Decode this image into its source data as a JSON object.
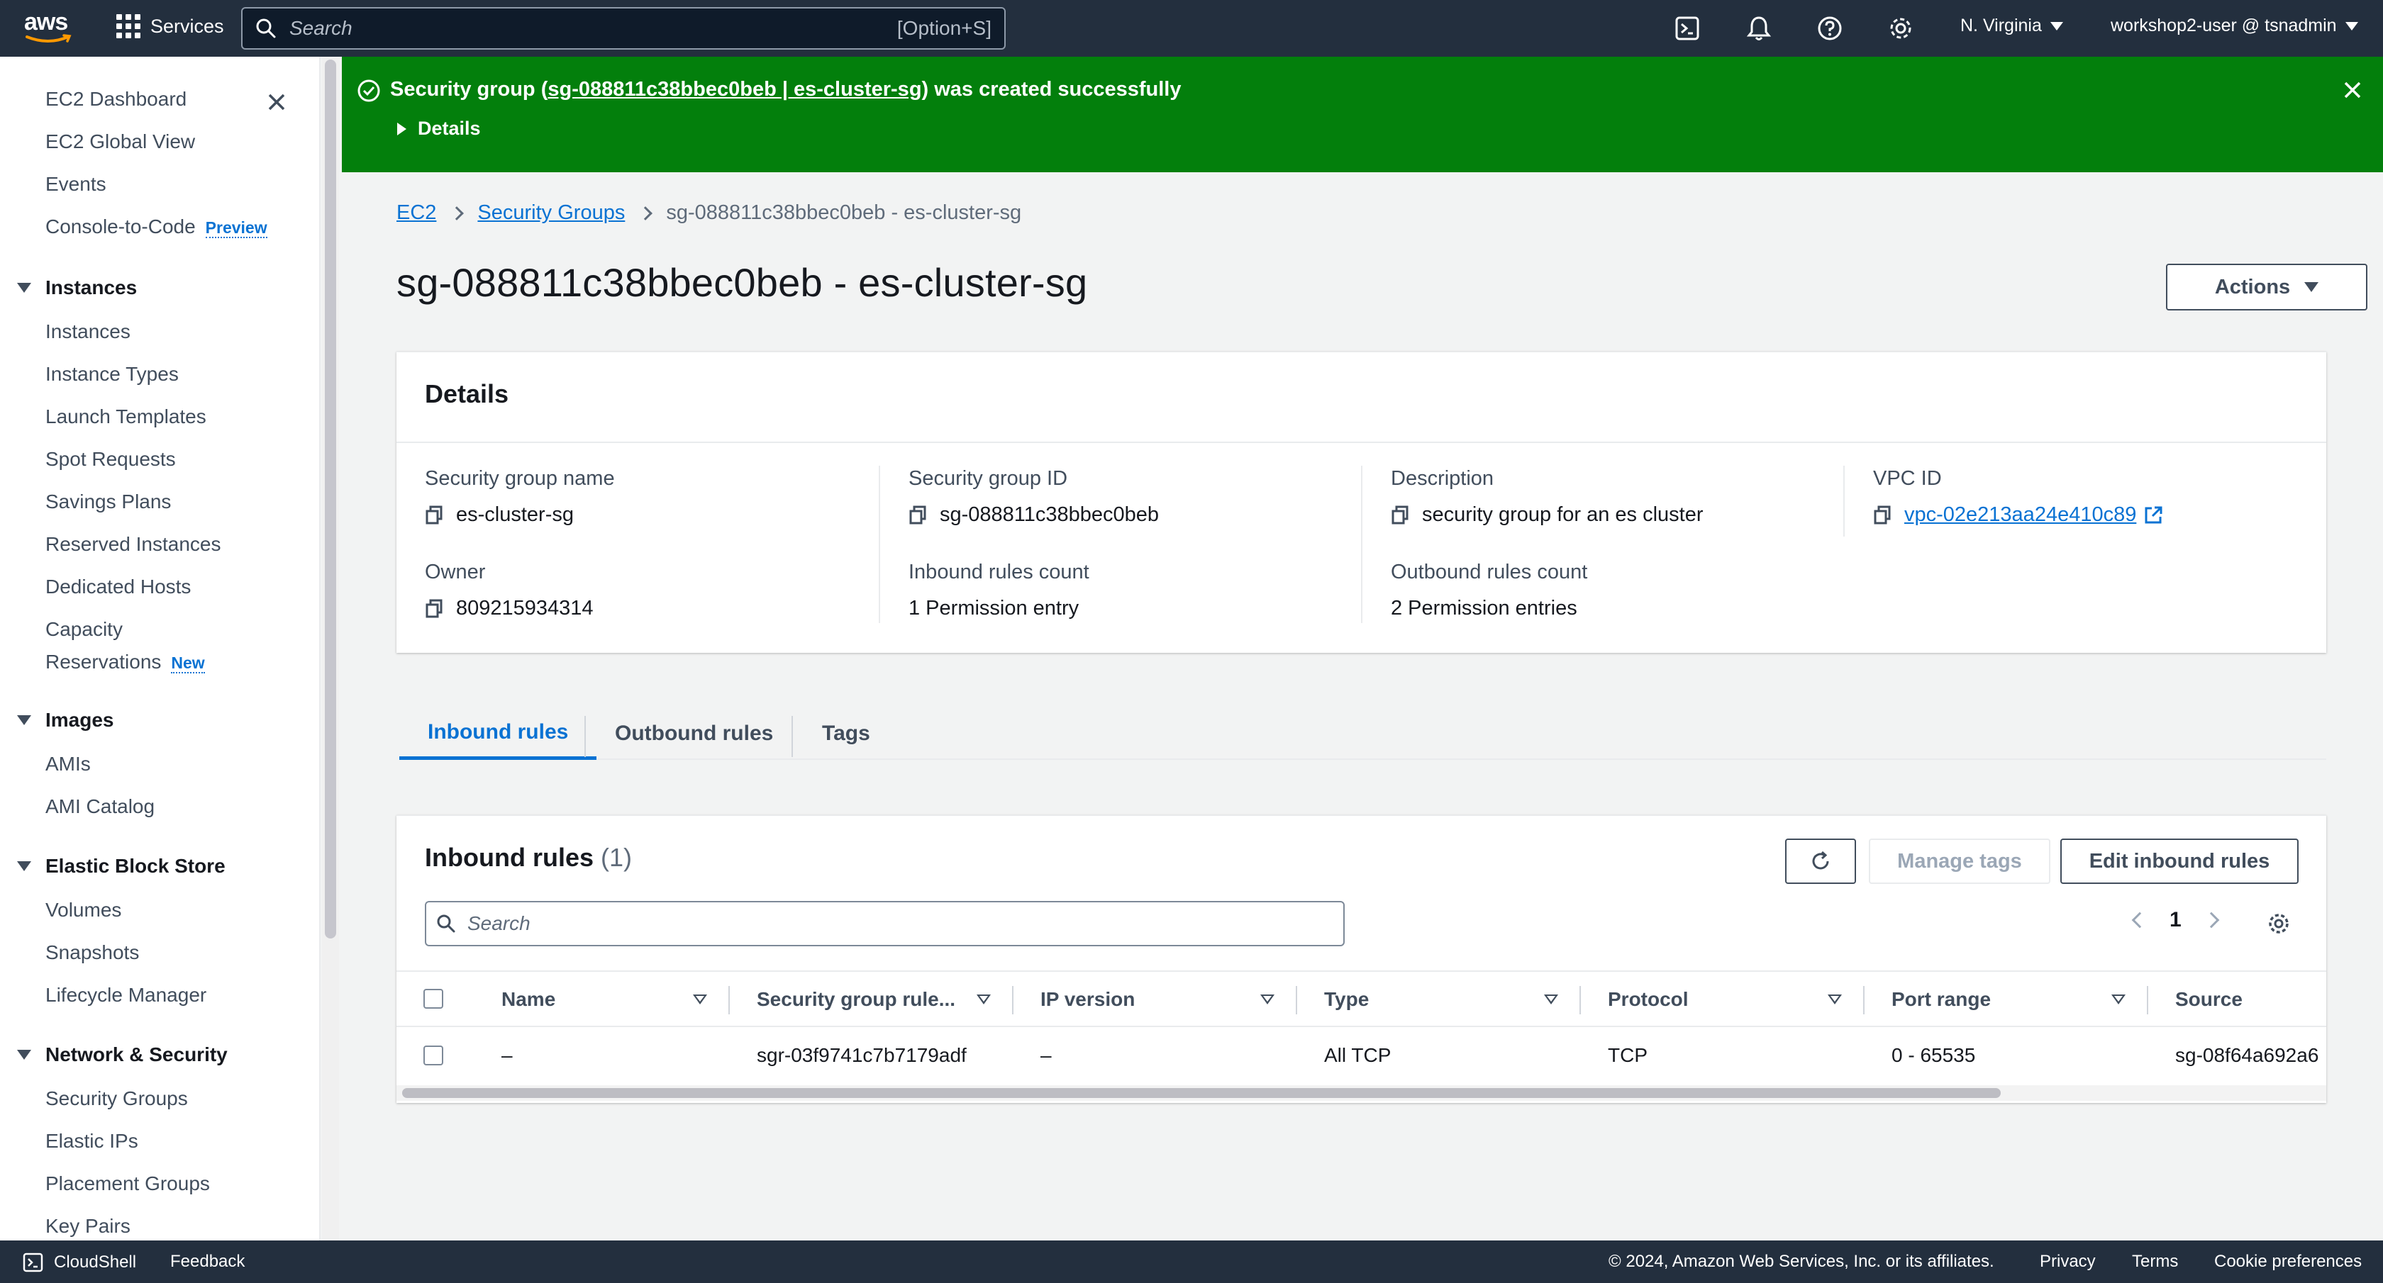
{
  "topnav": {
    "logo_text": "aws",
    "services_label": "Services",
    "search_placeholder": "Search",
    "search_shortcut": "[Option+S]",
    "icons": [
      "cloudshell-icon",
      "bell-icon",
      "help-icon",
      "gear-icon"
    ],
    "region": "N. Virginia",
    "account": "workshop2-user @ tsnadmin"
  },
  "sidebar": {
    "top_items": [
      {
        "label": "EC2 Dashboard"
      },
      {
        "label": "EC2 Global View"
      },
      {
        "label": "Events"
      },
      {
        "label": "Console-to-Code",
        "badge": "Preview"
      }
    ],
    "sections": [
      {
        "title": "Instances",
        "items": [
          "Instances",
          "Instance Types",
          "Launch Templates",
          "Spot Requests",
          "Savings Plans",
          "Reserved Instances",
          "Dedicated Hosts",
          "Capacity",
          "Reservations"
        ],
        "badge": "New"
      },
      {
        "title": "Images",
        "items": [
          "AMIs",
          "AMI Catalog"
        ]
      },
      {
        "title": "Elastic Block Store",
        "items": [
          "Volumes",
          "Snapshots",
          "Lifecycle Manager"
        ]
      },
      {
        "title": "Network & Security",
        "items": [
          "Security Groups",
          "Elastic IPs",
          "Placement Groups",
          "Key Pairs"
        ]
      }
    ]
  },
  "flash": {
    "prefix": "Security group (",
    "link": "sg-088811c38bbec0beb | es-cluster-sg",
    "suffix": ") was created successfully",
    "details_label": "Details",
    "color": "#037f0c"
  },
  "breadcrumb": {
    "items": [
      "EC2",
      "Security Groups"
    ],
    "current": "sg-088811c38bbec0beb - es-cluster-sg"
  },
  "page": {
    "title": "sg-088811c38bbec0beb - es-cluster-sg",
    "actions_label": "Actions"
  },
  "details": {
    "heading": "Details",
    "fields": {
      "sg_name_label": "Security group name",
      "sg_name": "es-cluster-sg",
      "sg_id_label": "Security group ID",
      "sg_id": "sg-088811c38bbec0beb",
      "description_label": "Description",
      "description": "security group for an es cluster",
      "vpc_label": "VPC ID",
      "vpc_id": "vpc-02e213aa24e410c89",
      "owner_label": "Owner",
      "owner": "809215934314",
      "inbound_count_label": "Inbound rules count",
      "inbound_count": "1 Permission entry",
      "outbound_count_label": "Outbound rules count",
      "outbound_count": "2 Permission entries"
    }
  },
  "tabs": [
    "Inbound rules",
    "Outbound rules",
    "Tags"
  ],
  "rules": {
    "title": "Inbound rules",
    "count": "(1)",
    "manage_tags_label": "Manage tags",
    "edit_label": "Edit inbound rules",
    "search_placeholder": "Search",
    "page": "1",
    "columns": [
      "Name",
      "Security group rule...",
      "IP version",
      "Type",
      "Protocol",
      "Port range",
      "Source"
    ],
    "rows": [
      {
        "name": "–",
        "rule_id": "sgr-03f9741c7b7179adf",
        "ip_version": "–",
        "type": "All TCP",
        "protocol": "TCP",
        "port_range": "0 - 65535",
        "source": "sg-08f64a692a6"
      }
    ]
  },
  "footer": {
    "cloudshell": "CloudShell",
    "feedback": "Feedback",
    "copyright": "© 2024, Amazon Web Services, Inc. or its affiliates.",
    "privacy": "Privacy",
    "terms": "Terms",
    "cookie": "Cookie preferences"
  }
}
